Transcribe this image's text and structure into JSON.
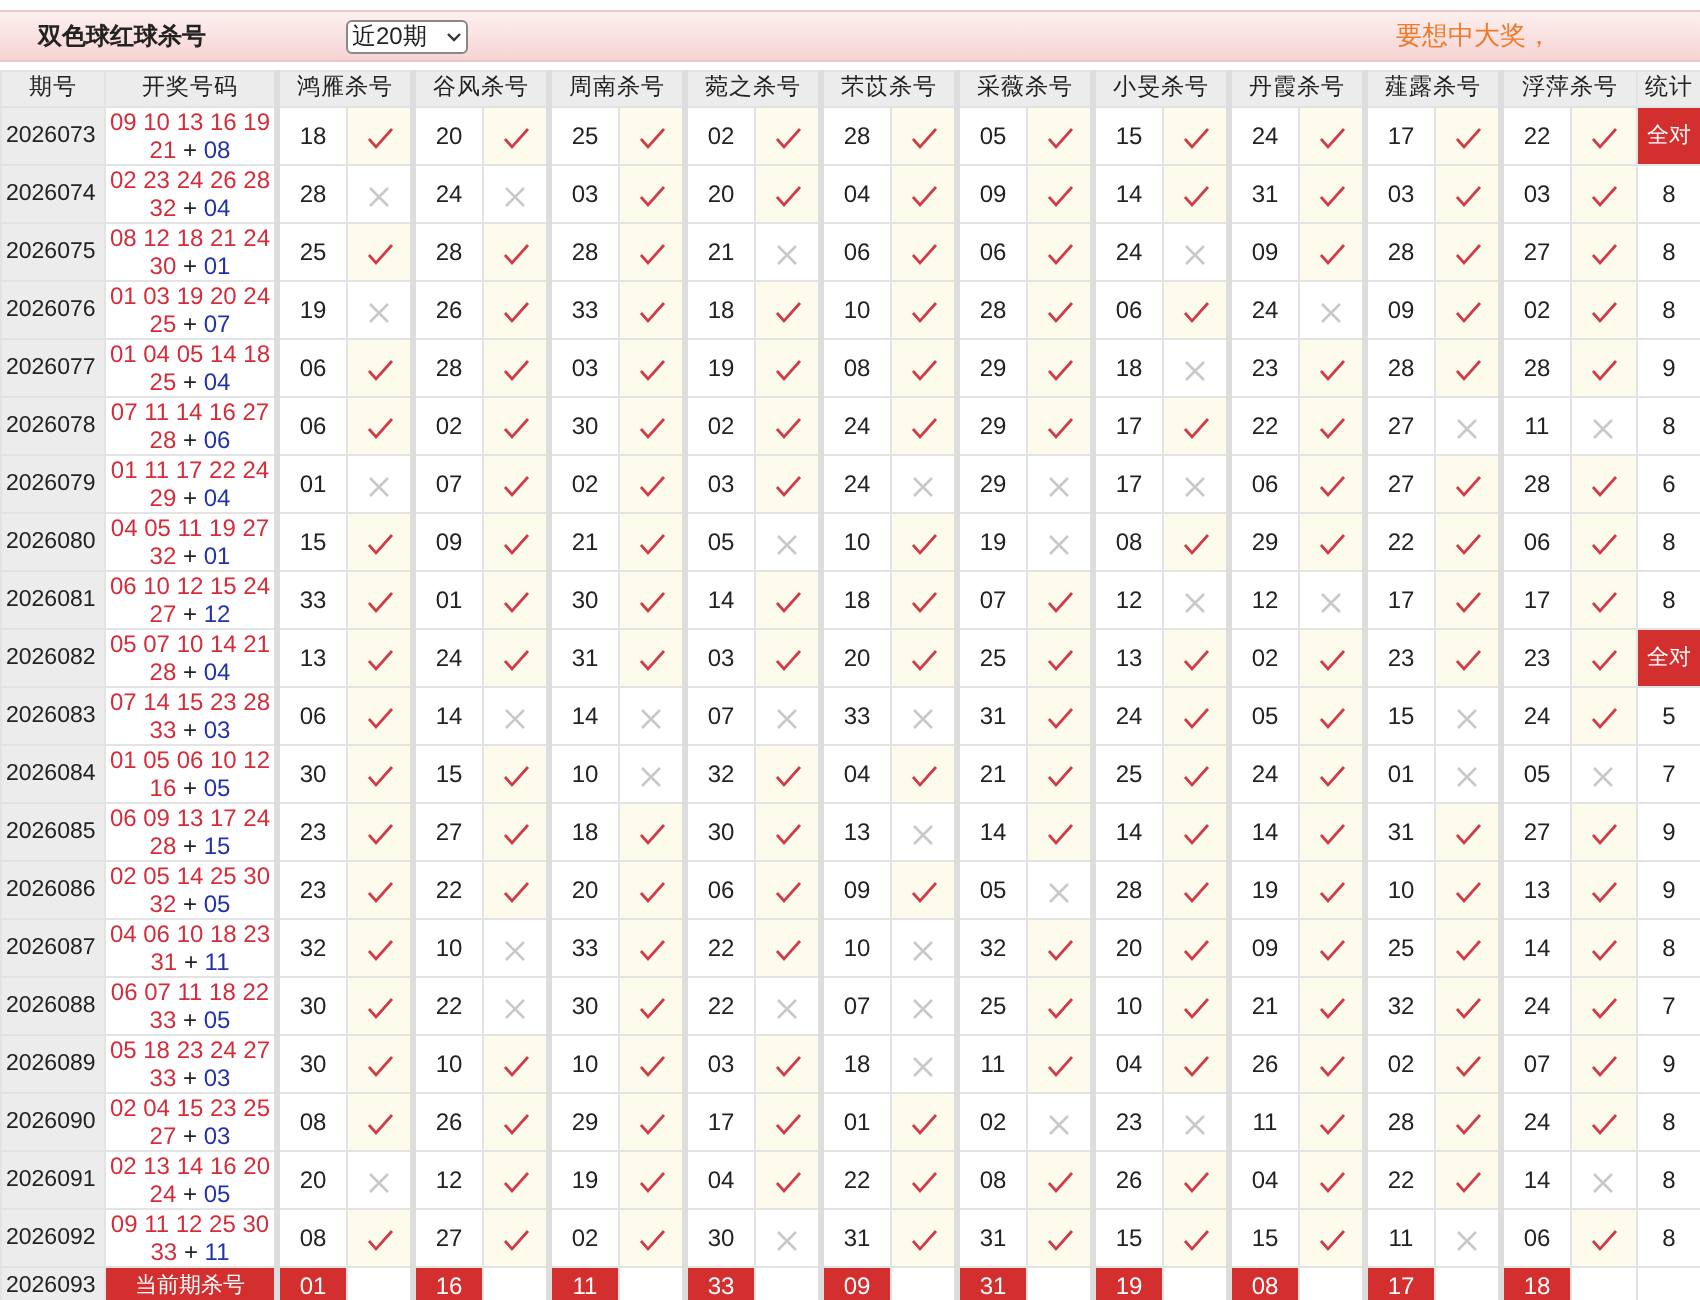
{
  "header": {
    "title": "双色球红球杀号",
    "range_select": "近20期",
    "slogan": "要想中大奖，"
  },
  "columns": [
    "期号",
    "开奖号码",
    "鸿雁杀号",
    "谷风杀号",
    "周南杀号",
    "菀之杀号",
    "芣苡杀号",
    "采薇杀号",
    "小旻杀号",
    "丹霞杀号",
    "薤露杀号",
    "浮萍杀号",
    "统计"
  ],
  "draw_separator": "+",
  "rows": [
    {
      "period": "2026073",
      "reds": [
        "09",
        "10",
        "13",
        "16",
        "19",
        "21"
      ],
      "blue": "08",
      "picks": [
        {
          "number": "18",
          "hit": true
        },
        {
          "number": "20",
          "hit": true
        },
        {
          "number": "25",
          "hit": true
        },
        {
          "number": "02",
          "hit": true
        },
        {
          "number": "28",
          "hit": true
        },
        {
          "number": "05",
          "hit": true
        },
        {
          "number": "15",
          "hit": true
        },
        {
          "number": "24",
          "hit": true
        },
        {
          "number": "17",
          "hit": true
        },
        {
          "number": "22",
          "hit": true
        }
      ],
      "stat": "全对",
      "all_correct": true
    },
    {
      "period": "2026074",
      "reds": [
        "02",
        "23",
        "24",
        "26",
        "28",
        "32"
      ],
      "blue": "04",
      "picks": [
        {
          "number": "28",
          "hit": false
        },
        {
          "number": "24",
          "hit": false
        },
        {
          "number": "03",
          "hit": true
        },
        {
          "number": "20",
          "hit": true
        },
        {
          "number": "04",
          "hit": true
        },
        {
          "number": "09",
          "hit": true
        },
        {
          "number": "14",
          "hit": true
        },
        {
          "number": "31",
          "hit": true
        },
        {
          "number": "03",
          "hit": true
        },
        {
          "number": "03",
          "hit": true
        }
      ],
      "stat": "8",
      "all_correct": false
    },
    {
      "period": "2026075",
      "reds": [
        "08",
        "12",
        "18",
        "21",
        "24",
        "30"
      ],
      "blue": "01",
      "picks": [
        {
          "number": "25",
          "hit": true
        },
        {
          "number": "28",
          "hit": true
        },
        {
          "number": "28",
          "hit": true
        },
        {
          "number": "21",
          "hit": false
        },
        {
          "number": "06",
          "hit": true
        },
        {
          "number": "06",
          "hit": true
        },
        {
          "number": "24",
          "hit": false
        },
        {
          "number": "09",
          "hit": true
        },
        {
          "number": "28",
          "hit": true
        },
        {
          "number": "27",
          "hit": true
        }
      ],
      "stat": "8",
      "all_correct": false
    },
    {
      "period": "2026076",
      "reds": [
        "01",
        "03",
        "19",
        "20",
        "24",
        "25"
      ],
      "blue": "07",
      "picks": [
        {
          "number": "19",
          "hit": false
        },
        {
          "number": "26",
          "hit": true
        },
        {
          "number": "33",
          "hit": true
        },
        {
          "number": "18",
          "hit": true
        },
        {
          "number": "10",
          "hit": true
        },
        {
          "number": "28",
          "hit": true
        },
        {
          "number": "06",
          "hit": true
        },
        {
          "number": "24",
          "hit": false
        },
        {
          "number": "09",
          "hit": true
        },
        {
          "number": "02",
          "hit": true
        }
      ],
      "stat": "8",
      "all_correct": false
    },
    {
      "period": "2026077",
      "reds": [
        "01",
        "04",
        "05",
        "14",
        "18",
        "25"
      ],
      "blue": "04",
      "picks": [
        {
          "number": "06",
          "hit": true
        },
        {
          "number": "28",
          "hit": true
        },
        {
          "number": "03",
          "hit": true
        },
        {
          "number": "19",
          "hit": true
        },
        {
          "number": "08",
          "hit": true
        },
        {
          "number": "29",
          "hit": true
        },
        {
          "number": "18",
          "hit": false
        },
        {
          "number": "23",
          "hit": true
        },
        {
          "number": "28",
          "hit": true
        },
        {
          "number": "28",
          "hit": true
        }
      ],
      "stat": "9",
      "all_correct": false
    },
    {
      "period": "2026078",
      "reds": [
        "07",
        "11",
        "14",
        "16",
        "27",
        "28"
      ],
      "blue": "06",
      "picks": [
        {
          "number": "06",
          "hit": true
        },
        {
          "number": "02",
          "hit": true
        },
        {
          "number": "30",
          "hit": true
        },
        {
          "number": "02",
          "hit": true
        },
        {
          "number": "24",
          "hit": true
        },
        {
          "number": "29",
          "hit": true
        },
        {
          "number": "17",
          "hit": true
        },
        {
          "number": "22",
          "hit": true
        },
        {
          "number": "27",
          "hit": false
        },
        {
          "number": "11",
          "hit": false
        }
      ],
      "stat": "8",
      "all_correct": false
    },
    {
      "period": "2026079",
      "reds": [
        "01",
        "11",
        "17",
        "22",
        "24",
        "29"
      ],
      "blue": "04",
      "picks": [
        {
          "number": "01",
          "hit": false
        },
        {
          "number": "07",
          "hit": true
        },
        {
          "number": "02",
          "hit": true
        },
        {
          "number": "03",
          "hit": true
        },
        {
          "number": "24",
          "hit": false
        },
        {
          "number": "29",
          "hit": false
        },
        {
          "number": "17",
          "hit": false
        },
        {
          "number": "06",
          "hit": true
        },
        {
          "number": "27",
          "hit": true
        },
        {
          "number": "28",
          "hit": true
        }
      ],
      "stat": "6",
      "all_correct": false
    },
    {
      "period": "2026080",
      "reds": [
        "04",
        "05",
        "11",
        "19",
        "27",
        "32"
      ],
      "blue": "01",
      "picks": [
        {
          "number": "15",
          "hit": true
        },
        {
          "number": "09",
          "hit": true
        },
        {
          "number": "21",
          "hit": true
        },
        {
          "number": "05",
          "hit": false
        },
        {
          "number": "10",
          "hit": true
        },
        {
          "number": "19",
          "hit": false
        },
        {
          "number": "08",
          "hit": true
        },
        {
          "number": "29",
          "hit": true
        },
        {
          "number": "22",
          "hit": true
        },
        {
          "number": "06",
          "hit": true
        }
      ],
      "stat": "8",
      "all_correct": false
    },
    {
      "period": "2026081",
      "reds": [
        "06",
        "10",
        "12",
        "15",
        "24",
        "27"
      ],
      "blue": "12",
      "picks": [
        {
          "number": "33",
          "hit": true
        },
        {
          "number": "01",
          "hit": true
        },
        {
          "number": "30",
          "hit": true
        },
        {
          "number": "14",
          "hit": true
        },
        {
          "number": "18",
          "hit": true
        },
        {
          "number": "07",
          "hit": true
        },
        {
          "number": "12",
          "hit": false
        },
        {
          "number": "12",
          "hit": false
        },
        {
          "number": "17",
          "hit": true
        },
        {
          "number": "17",
          "hit": true
        }
      ],
      "stat": "8",
      "all_correct": false
    },
    {
      "period": "2026082",
      "reds": [
        "05",
        "07",
        "10",
        "14",
        "21",
        "28"
      ],
      "blue": "04",
      "picks": [
        {
          "number": "13",
          "hit": true
        },
        {
          "number": "24",
          "hit": true
        },
        {
          "number": "31",
          "hit": true
        },
        {
          "number": "03",
          "hit": true
        },
        {
          "number": "20",
          "hit": true
        },
        {
          "number": "25",
          "hit": true
        },
        {
          "number": "13",
          "hit": true
        },
        {
          "number": "02",
          "hit": true
        },
        {
          "number": "23",
          "hit": true
        },
        {
          "number": "23",
          "hit": true
        }
      ],
      "stat": "全对",
      "all_correct": true
    },
    {
      "period": "2026083",
      "reds": [
        "07",
        "14",
        "15",
        "23",
        "28",
        "33"
      ],
      "blue": "03",
      "picks": [
        {
          "number": "06",
          "hit": true
        },
        {
          "number": "14",
          "hit": false
        },
        {
          "number": "14",
          "hit": false
        },
        {
          "number": "07",
          "hit": false
        },
        {
          "number": "33",
          "hit": false
        },
        {
          "number": "31",
          "hit": true
        },
        {
          "number": "24",
          "hit": true
        },
        {
          "number": "05",
          "hit": true
        },
        {
          "number": "15",
          "hit": false
        },
        {
          "number": "24",
          "hit": true
        }
      ],
      "stat": "5",
      "all_correct": false
    },
    {
      "period": "2026084",
      "reds": [
        "01",
        "05",
        "06",
        "10",
        "12",
        "16"
      ],
      "blue": "05",
      "picks": [
        {
          "number": "30",
          "hit": true
        },
        {
          "number": "15",
          "hit": true
        },
        {
          "number": "10",
          "hit": false
        },
        {
          "number": "32",
          "hit": true
        },
        {
          "number": "04",
          "hit": true
        },
        {
          "number": "21",
          "hit": true
        },
        {
          "number": "25",
          "hit": true
        },
        {
          "number": "24",
          "hit": true
        },
        {
          "number": "01",
          "hit": false
        },
        {
          "number": "05",
          "hit": false
        }
      ],
      "stat": "7",
      "all_correct": false
    },
    {
      "period": "2026085",
      "reds": [
        "06",
        "09",
        "13",
        "17",
        "24",
        "28"
      ],
      "blue": "15",
      "picks": [
        {
          "number": "23",
          "hit": true
        },
        {
          "number": "27",
          "hit": true
        },
        {
          "number": "18",
          "hit": true
        },
        {
          "number": "30",
          "hit": true
        },
        {
          "number": "13",
          "hit": false
        },
        {
          "number": "14",
          "hit": true
        },
        {
          "number": "14",
          "hit": true
        },
        {
          "number": "14",
          "hit": true
        },
        {
          "number": "31",
          "hit": true
        },
        {
          "number": "27",
          "hit": true
        }
      ],
      "stat": "9",
      "all_correct": false
    },
    {
      "period": "2026086",
      "reds": [
        "02",
        "05",
        "14",
        "25",
        "30",
        "32"
      ],
      "blue": "05",
      "picks": [
        {
          "number": "23",
          "hit": true
        },
        {
          "number": "22",
          "hit": true
        },
        {
          "number": "20",
          "hit": true
        },
        {
          "number": "06",
          "hit": true
        },
        {
          "number": "09",
          "hit": true
        },
        {
          "number": "05",
          "hit": false
        },
        {
          "number": "28",
          "hit": true
        },
        {
          "number": "19",
          "hit": true
        },
        {
          "number": "10",
          "hit": true
        },
        {
          "number": "13",
          "hit": true
        }
      ],
      "stat": "9",
      "all_correct": false
    },
    {
      "period": "2026087",
      "reds": [
        "04",
        "06",
        "10",
        "18",
        "23",
        "31"
      ],
      "blue": "11",
      "picks": [
        {
          "number": "32",
          "hit": true
        },
        {
          "number": "10",
          "hit": false
        },
        {
          "number": "33",
          "hit": true
        },
        {
          "number": "22",
          "hit": true
        },
        {
          "number": "10",
          "hit": false
        },
        {
          "number": "32",
          "hit": true
        },
        {
          "number": "20",
          "hit": true
        },
        {
          "number": "09",
          "hit": true
        },
        {
          "number": "25",
          "hit": true
        },
        {
          "number": "14",
          "hit": true
        }
      ],
      "stat": "8",
      "all_correct": false
    },
    {
      "period": "2026088",
      "reds": [
        "06",
        "07",
        "11",
        "18",
        "22",
        "33"
      ],
      "blue": "05",
      "picks": [
        {
          "number": "30",
          "hit": true
        },
        {
          "number": "22",
          "hit": false
        },
        {
          "number": "30",
          "hit": true
        },
        {
          "number": "22",
          "hit": false
        },
        {
          "number": "07",
          "hit": false
        },
        {
          "number": "25",
          "hit": true
        },
        {
          "number": "10",
          "hit": true
        },
        {
          "number": "21",
          "hit": true
        },
        {
          "number": "32",
          "hit": true
        },
        {
          "number": "24",
          "hit": true
        }
      ],
      "stat": "7",
      "all_correct": false
    },
    {
      "period": "2026089",
      "reds": [
        "05",
        "18",
        "23",
        "24",
        "27",
        "33"
      ],
      "blue": "03",
      "picks": [
        {
          "number": "30",
          "hit": true
        },
        {
          "number": "10",
          "hit": true
        },
        {
          "number": "10",
          "hit": true
        },
        {
          "number": "03",
          "hit": true
        },
        {
          "number": "18",
          "hit": false
        },
        {
          "number": "11",
          "hit": true
        },
        {
          "number": "04",
          "hit": true
        },
        {
          "number": "26",
          "hit": true
        },
        {
          "number": "02",
          "hit": true
        },
        {
          "number": "07",
          "hit": true
        }
      ],
      "stat": "9",
      "all_correct": false
    },
    {
      "period": "2026090",
      "reds": [
        "02",
        "04",
        "15",
        "23",
        "25",
        "27"
      ],
      "blue": "03",
      "picks": [
        {
          "number": "08",
          "hit": true
        },
        {
          "number": "26",
          "hit": true
        },
        {
          "number": "29",
          "hit": true
        },
        {
          "number": "17",
          "hit": true
        },
        {
          "number": "01",
          "hit": true
        },
        {
          "number": "02",
          "hit": false
        },
        {
          "number": "23",
          "hit": false
        },
        {
          "number": "11",
          "hit": true
        },
        {
          "number": "28",
          "hit": true
        },
        {
          "number": "24",
          "hit": true
        }
      ],
      "stat": "8",
      "all_correct": false
    },
    {
      "period": "2026091",
      "reds": [
        "02",
        "13",
        "14",
        "16",
        "20",
        "24"
      ],
      "blue": "05",
      "picks": [
        {
          "number": "20",
          "hit": false
        },
        {
          "number": "12",
          "hit": true
        },
        {
          "number": "19",
          "hit": true
        },
        {
          "number": "04",
          "hit": true
        },
        {
          "number": "22",
          "hit": true
        },
        {
          "number": "08",
          "hit": true
        },
        {
          "number": "26",
          "hit": true
        },
        {
          "number": "04",
          "hit": true
        },
        {
          "number": "22",
          "hit": true
        },
        {
          "number": "14",
          "hit": false
        }
      ],
      "stat": "8",
      "all_correct": false
    },
    {
      "period": "2026092",
      "reds": [
        "09",
        "11",
        "12",
        "25",
        "30",
        "33"
      ],
      "blue": "11",
      "picks": [
        {
          "number": "08",
          "hit": true
        },
        {
          "number": "27",
          "hit": true
        },
        {
          "number": "02",
          "hit": true
        },
        {
          "number": "30",
          "hit": false
        },
        {
          "number": "31",
          "hit": true
        },
        {
          "number": "31",
          "hit": true
        },
        {
          "number": "15",
          "hit": true
        },
        {
          "number": "15",
          "hit": true
        },
        {
          "number": "11",
          "hit": false
        },
        {
          "number": "06",
          "hit": true
        }
      ],
      "stat": "8",
      "all_correct": false
    }
  ],
  "current": {
    "period": "2026093",
    "label": "当前期杀号",
    "picks": [
      "01",
      "16",
      "11",
      "33",
      "09",
      "31",
      "19",
      "08",
      "17",
      "18"
    ]
  }
}
